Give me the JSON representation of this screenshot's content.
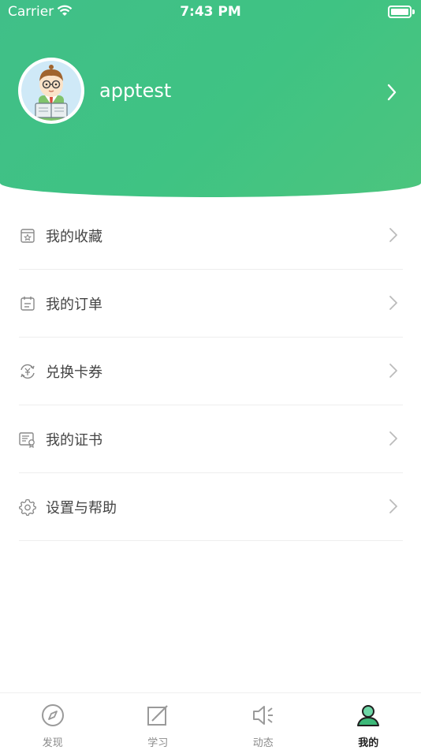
{
  "status_bar": {
    "carrier": "Carrier",
    "time": "7:43 PM"
  },
  "profile": {
    "username": "apptest"
  },
  "menu": {
    "items": [
      {
        "label": "我的收藏",
        "icon": "favorites-icon"
      },
      {
        "label": "我的订单",
        "icon": "orders-icon"
      },
      {
        "label": "兑换卡券",
        "icon": "coupon-exchange-icon"
      },
      {
        "label": "我的证书",
        "icon": "certificate-icon"
      },
      {
        "label": "设置与帮助",
        "icon": "settings-icon"
      }
    ]
  },
  "tabbar": {
    "tabs": [
      {
        "label": "发现",
        "icon": "compass-icon",
        "active": false
      },
      {
        "label": "学习",
        "icon": "edit-note-icon",
        "active": false
      },
      {
        "label": "动态",
        "icon": "speaker-icon",
        "active": false
      },
      {
        "label": "我的",
        "icon": "user-icon",
        "active": true
      }
    ]
  },
  "colors": {
    "header_green": "#40bf88",
    "active_tab": "#3cb878",
    "text": "#444444"
  }
}
